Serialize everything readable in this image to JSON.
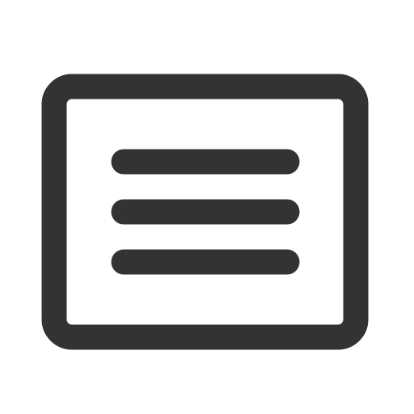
{
  "icon": {
    "name": "text-panel-icon",
    "meaning": "",
    "colors": {
      "stroke": "#323335",
      "fill": "#ffffff",
      "background": "#ffffff"
    }
  }
}
